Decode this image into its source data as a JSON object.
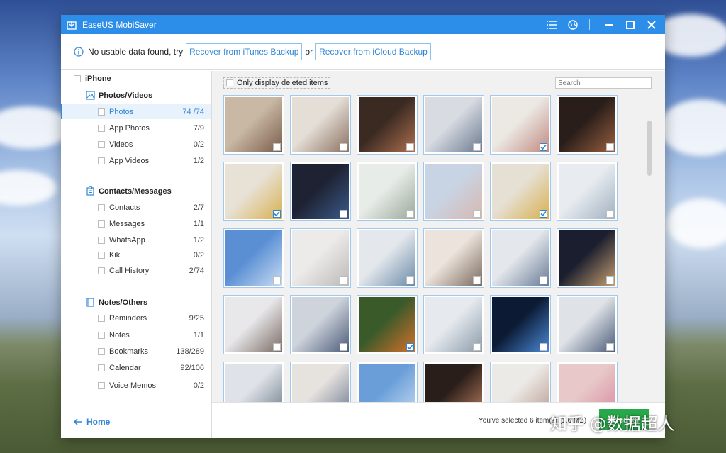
{
  "window": {
    "title": "EaseUS MobiSaver",
    "colors": {
      "titlebar": "#2c8ee8",
      "accent": "#2f86d6",
      "recover": "#27a84a"
    },
    "icons": [
      "app-icon",
      "menu-icon",
      "globe-icon",
      "minimize-icon",
      "maximize-icon",
      "close-icon"
    ]
  },
  "infobar": {
    "message": "No usable data found, try",
    "itunes_label": "Recover from iTunes Backup",
    "or": "or",
    "icloud_label": "Recover from iCloud Backup"
  },
  "sidebar": {
    "device": "iPhone",
    "groups": [
      {
        "title": "Photos/Videos",
        "items": [
          {
            "label": "Photos",
            "count": "74 /74"
          },
          {
            "label": "App Photos",
            "count": "7/9"
          },
          {
            "label": "Videos",
            "count": "0/2"
          },
          {
            "label": "App Videos",
            "count": "1/2"
          }
        ]
      },
      {
        "title": "Contacts/Messages",
        "items": [
          {
            "label": "Contacts",
            "count": "2/7"
          },
          {
            "label": "Messages",
            "count": "1/1"
          },
          {
            "label": "WhatsApp",
            "count": "1/2"
          },
          {
            "label": "Kik",
            "count": "0/2"
          },
          {
            "label": "Call History",
            "count": "2/74"
          }
        ]
      },
      {
        "title": "Notes/Others",
        "items": [
          {
            "label": "Reminders",
            "count": "9/25"
          },
          {
            "label": "Notes",
            "count": "1/1"
          },
          {
            "label": "Bookmarks",
            "count": "138/289"
          },
          {
            "label": "Calendar",
            "count": "92/106"
          },
          {
            "label": "Voice Memos",
            "count": "0/2"
          }
        ]
      }
    ],
    "home_label": "Home"
  },
  "main": {
    "only_deleted_label": "Only display deleted items",
    "search_placeholder": "Search",
    "thumbnails_checked": [
      false,
      false,
      false,
      false,
      true,
      false,
      true,
      false,
      false,
      false,
      true,
      false,
      false,
      false,
      false,
      false,
      false,
      false,
      false,
      false,
      true,
      false,
      false,
      false,
      false,
      false,
      false,
      false,
      false,
      false
    ],
    "status_text": "You've selected 6 item(s) (1.6 MB)",
    "recover_label": "Recover"
  },
  "watermark": "知乎 @数据超人"
}
